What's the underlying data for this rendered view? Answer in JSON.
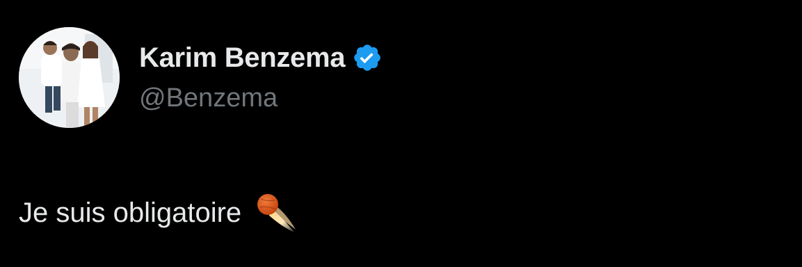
{
  "author": {
    "display_name": "Karim Benzema",
    "handle": "@Benzema",
    "verified_icon": "verified-badge-icon",
    "verified_color": "#1d9bf0"
  },
  "tweet": {
    "text": "Je suis obligatoire",
    "emoji": "comet-emoji"
  },
  "colors": {
    "background": "#000000",
    "primary_text": "#e7e9ea",
    "secondary_text": "#71767b"
  }
}
